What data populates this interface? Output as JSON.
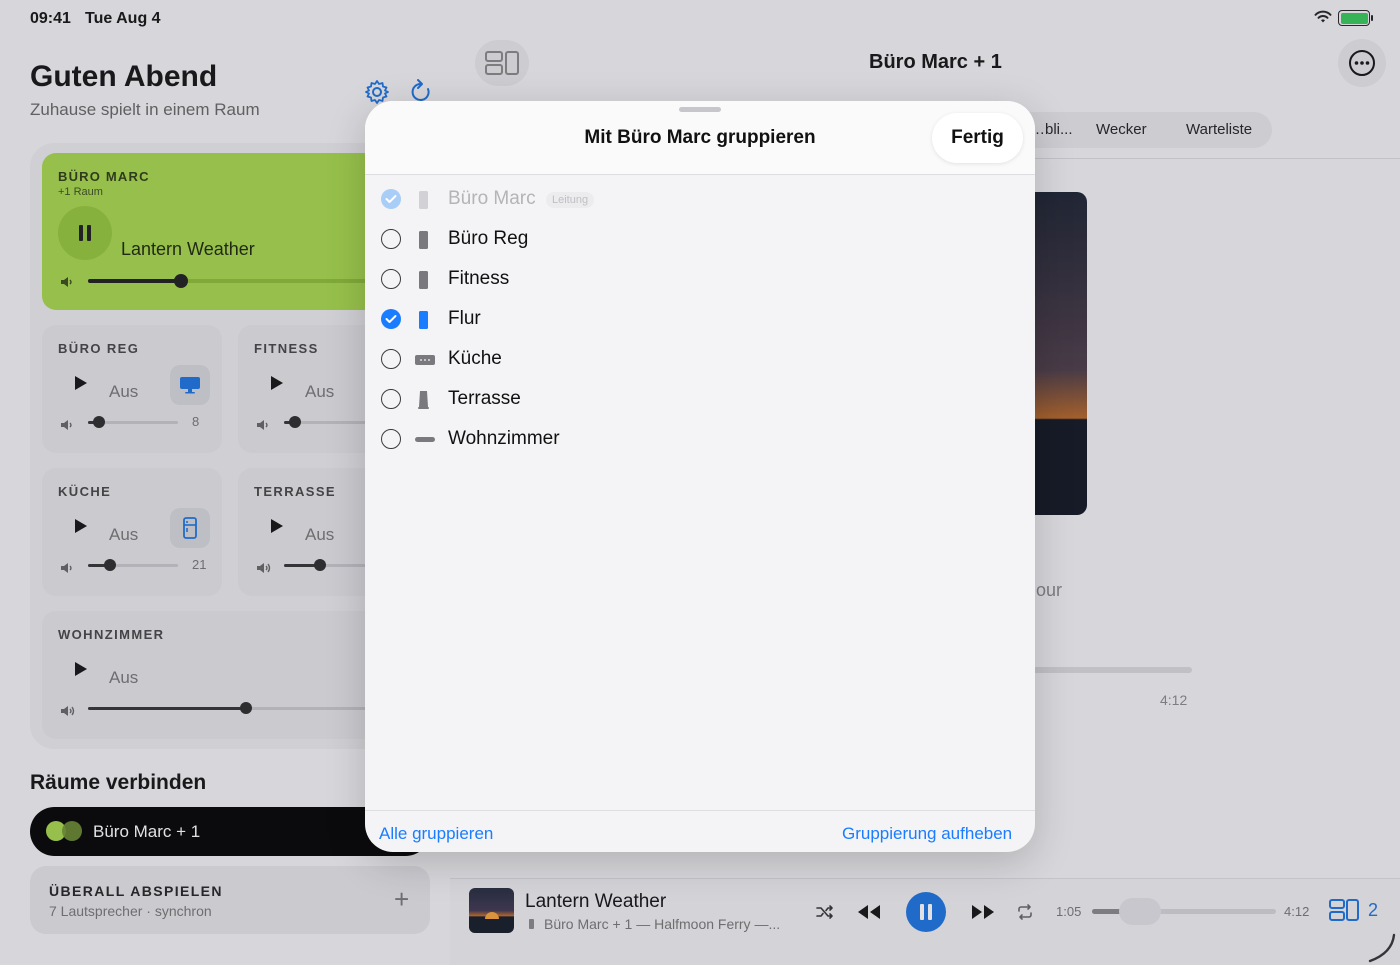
{
  "status_bar": {
    "time": "09:41",
    "date": "Tue Aug 4"
  },
  "left": {
    "title": "Guten Abend",
    "subtitle": "Zuhause spielt in einem Raum",
    "main_room": {
      "name": "BÜRO MARC",
      "sub": "+1 Raum",
      "track": "Lantern Weather",
      "volume_fraction": 0.3,
      "accent": "#a6d84a"
    },
    "rooms": [
      {
        "name": "BÜRO REG",
        "state": "Aus",
        "volume": "8",
        "device_icon": "monitor-icon"
      },
      {
        "name": "FITNESS",
        "state": "Aus",
        "volume": "",
        "device_icon": ""
      },
      {
        "name": "KÜCHE",
        "state": "Aus",
        "volume": "21",
        "device_icon": "fridge-icon"
      },
      {
        "name": "TERRASSE",
        "state": "Aus",
        "volume": "",
        "device_icon": ""
      },
      {
        "name": "WOHNZIMMER",
        "state": "Aus",
        "volume": "",
        "device_icon": ""
      }
    ],
    "connect_title": "Räume verbinden",
    "group_pill_label": "Büro Marc + 1",
    "play_everywhere": {
      "title": "ÜBERALL ABSPIELEN",
      "sub": "7 Lautsprecher · synchron",
      "plus": "+"
    }
  },
  "right": {
    "title": "Büro Marc + 1",
    "tabs": [
      "…bli...",
      "Wecker",
      "Warteliste"
    ],
    "partial_text": "our",
    "duration": "4:12"
  },
  "mini_player": {
    "track": "Lantern Weather",
    "sub": "Büro Marc + 1 — Halfmoon Ferry —...",
    "elapsed": "1:05",
    "duration": "4:12",
    "progress_fraction": 0.26,
    "group_count": "2",
    "accent": "#1a73e0"
  },
  "modal": {
    "title": "Mit Büro Marc gruppieren",
    "done_label": "Fertig",
    "rows": [
      {
        "name": "Büro Marc",
        "badge": "Leitung",
        "state": "disabled",
        "device": "speaker"
      },
      {
        "name": "Büro Reg",
        "state": "unchecked",
        "device": "speaker"
      },
      {
        "name": "Fitness",
        "state": "unchecked",
        "device": "speaker"
      },
      {
        "name": "Flur",
        "state": "checked",
        "device": "speaker-blue"
      },
      {
        "name": "Küche",
        "state": "unchecked",
        "device": "soundbar"
      },
      {
        "name": "Terrasse",
        "state": "unchecked",
        "device": "speaker-tall"
      },
      {
        "name": "Wohnzimmer",
        "state": "unchecked",
        "device": "soundbar-slim"
      }
    ],
    "footer_left": "Alle gruppieren",
    "footer_right": "Gruppierung aufheben"
  }
}
